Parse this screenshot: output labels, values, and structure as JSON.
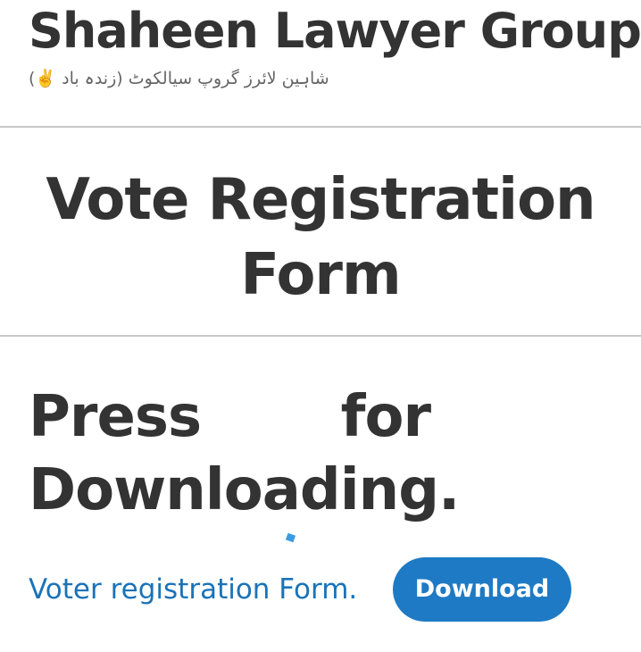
{
  "header": {
    "site_title": "Shaheen Lawyer Group",
    "tagline": "شاہین لائرز گروپ سیالکوٹ (زندہ باد ✌️)"
  },
  "main": {
    "page_title": "Vote Registration Form",
    "download_prompt": "Press for Downloading."
  },
  "file_block": {
    "link_label": "Voter registration Form.",
    "button_label": "Download",
    "link_color": "#1a73b8",
    "button_color": "#1e7ac4"
  }
}
